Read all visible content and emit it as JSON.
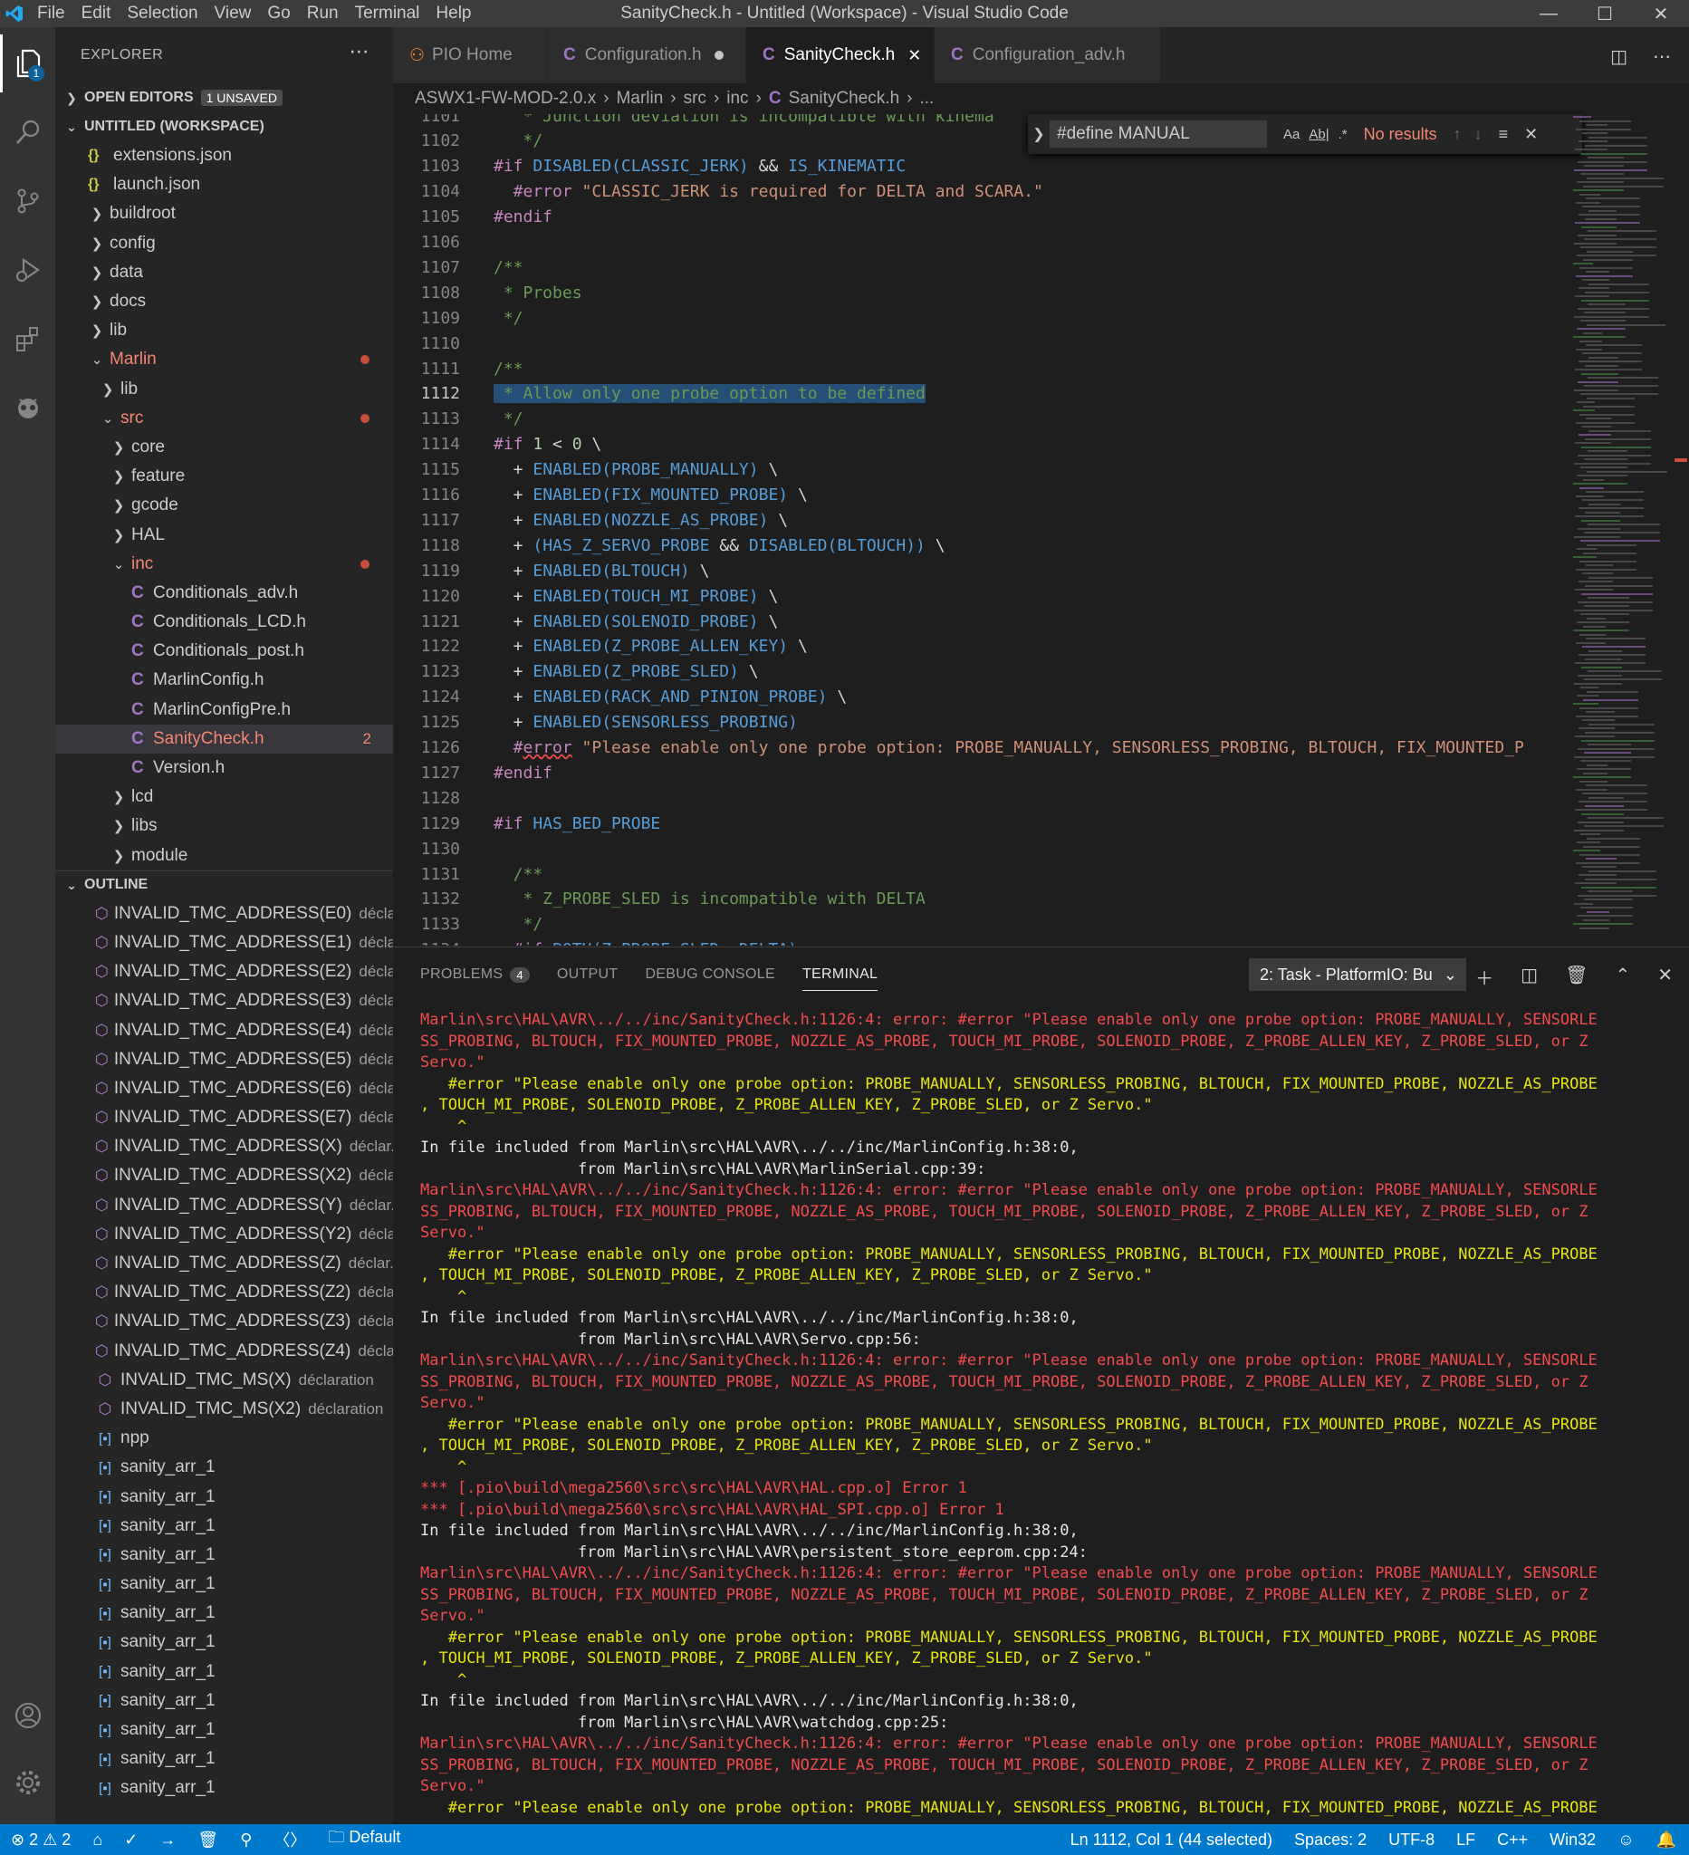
{
  "titlebar": {
    "menu": [
      "File",
      "Edit",
      "Selection",
      "View",
      "Go",
      "Run",
      "Terminal",
      "Help"
    ],
    "title": "SanityCheck.h - Untitled (Workspace) - Visual Studio Code"
  },
  "activity": {
    "explorer_badge": "1"
  },
  "sidebar": {
    "header": "EXPLORER",
    "open_editors": "OPEN EDITORS",
    "unsaved": "1 UNSAVED",
    "workspace": "UNTITLED (WORKSPACE)",
    "tree": [
      {
        "label": "extensions.json",
        "type": "json",
        "indent": 36
      },
      {
        "label": "launch.json",
        "type": "json",
        "indent": 36
      },
      {
        "label": "buildroot",
        "type": "folder",
        "indent": 36
      },
      {
        "label": "config",
        "type": "folder",
        "indent": 36
      },
      {
        "label": "data",
        "type": "folder",
        "indent": 36
      },
      {
        "label": "docs",
        "type": "folder",
        "indent": 36
      },
      {
        "label": "lib",
        "type": "folder",
        "indent": 36
      },
      {
        "label": "Marlin",
        "type": "folder-open",
        "indent": 36,
        "err": true,
        "dot": true
      },
      {
        "label": "lib",
        "type": "folder",
        "indent": 48
      },
      {
        "label": "src",
        "type": "folder-open",
        "indent": 48,
        "err": true,
        "dot": true
      },
      {
        "label": "core",
        "type": "folder",
        "indent": 60
      },
      {
        "label": "feature",
        "type": "folder",
        "indent": 60
      },
      {
        "label": "gcode",
        "type": "folder",
        "indent": 60
      },
      {
        "label": "HAL",
        "type": "folder",
        "indent": 60
      },
      {
        "label": "inc",
        "type": "folder-open",
        "indent": 60,
        "err": true,
        "dot": true
      },
      {
        "label": "Conditionals_adv.h",
        "type": "c",
        "indent": 72
      },
      {
        "label": "Conditionals_LCD.h",
        "type": "c",
        "indent": 72
      },
      {
        "label": "Conditionals_post.h",
        "type": "c",
        "indent": 72
      },
      {
        "label": "MarlinConfig.h",
        "type": "c",
        "indent": 72
      },
      {
        "label": "MarlinConfigPre.h",
        "type": "c",
        "indent": 72
      },
      {
        "label": "SanityCheck.h",
        "type": "c",
        "indent": 72,
        "err": true,
        "selected": true,
        "count": "2"
      },
      {
        "label": "Version.h",
        "type": "c",
        "indent": 72
      },
      {
        "label": "lcd",
        "type": "folder",
        "indent": 60
      },
      {
        "label": "libs",
        "type": "folder",
        "indent": 60
      },
      {
        "label": "module",
        "type": "folder",
        "indent": 60
      }
    ],
    "outline_title": "OUTLINE",
    "outline": [
      {
        "label": "INVALID_TMC_ADDRESS(E0)",
        "detail": "déclа...",
        "kind": "sym"
      },
      {
        "label": "INVALID_TMC_ADDRESS(E1)",
        "detail": "déclа...",
        "kind": "sym"
      },
      {
        "label": "INVALID_TMC_ADDRESS(E2)",
        "detail": "déclа...",
        "kind": "sym"
      },
      {
        "label": "INVALID_TMC_ADDRESS(E3)",
        "detail": "déclа...",
        "kind": "sym"
      },
      {
        "label": "INVALID_TMC_ADDRESS(E4)",
        "detail": "déclа...",
        "kind": "sym"
      },
      {
        "label": "INVALID_TMC_ADDRESS(E5)",
        "detail": "déclа...",
        "kind": "sym"
      },
      {
        "label": "INVALID_TMC_ADDRESS(E6)",
        "detail": "déclа...",
        "kind": "sym"
      },
      {
        "label": "INVALID_TMC_ADDRESS(E7)",
        "detail": "déclа...",
        "kind": "sym"
      },
      {
        "label": "INVALID_TMC_ADDRESS(X)",
        "detail": "déclar...",
        "kind": "sym"
      },
      {
        "label": "INVALID_TMC_ADDRESS(X2)",
        "detail": "déclа...",
        "kind": "sym"
      },
      {
        "label": "INVALID_TMC_ADDRESS(Y)",
        "detail": "déclar...",
        "kind": "sym"
      },
      {
        "label": "INVALID_TMC_ADDRESS(Y2)",
        "detail": "déclа...",
        "kind": "sym"
      },
      {
        "label": "INVALID_TMC_ADDRESS(Z)",
        "detail": "déclar...",
        "kind": "sym"
      },
      {
        "label": "INVALID_TMC_ADDRESS(Z2)",
        "detail": "déclа...",
        "kind": "sym"
      },
      {
        "label": "INVALID_TMC_ADDRESS(Z3)",
        "detail": "déclа...",
        "kind": "sym"
      },
      {
        "label": "INVALID_TMC_ADDRESS(Z4)",
        "detail": "déclа...",
        "kind": "sym"
      },
      {
        "label": "INVALID_TMC_MS(X)",
        "detail": "déclaration",
        "kind": "sym"
      },
      {
        "label": "INVALID_TMC_MS(X2)",
        "detail": "déclaration",
        "kind": "sym"
      },
      {
        "label": "npp",
        "detail": "",
        "kind": "var"
      },
      {
        "label": "sanity_arr_1",
        "detail": "",
        "kind": "var"
      },
      {
        "label": "sanity_arr_1",
        "detail": "",
        "kind": "var"
      },
      {
        "label": "sanity_arr_1",
        "detail": "",
        "kind": "var"
      },
      {
        "label": "sanity_arr_1",
        "detail": "",
        "kind": "var"
      },
      {
        "label": "sanity_arr_1",
        "detail": "",
        "kind": "var"
      },
      {
        "label": "sanity_arr_1",
        "detail": "",
        "kind": "var"
      },
      {
        "label": "sanity_arr_1",
        "detail": "",
        "kind": "var"
      },
      {
        "label": "sanity_arr_1",
        "detail": "",
        "kind": "var"
      },
      {
        "label": "sanity_arr_1",
        "detail": "",
        "kind": "var"
      },
      {
        "label": "sanity_arr_1",
        "detail": "",
        "kind": "var"
      },
      {
        "label": "sanity_arr_1",
        "detail": "",
        "kind": "var"
      },
      {
        "label": "sanity_arr_1",
        "detail": "",
        "kind": "var"
      }
    ]
  },
  "tabs": [
    {
      "label": "PIO Home",
      "icon": "pio",
      "active": false
    },
    {
      "label": "Configuration.h",
      "icon": "c",
      "active": false,
      "modified": true
    },
    {
      "label": "SanityCheck.h",
      "icon": "c",
      "active": true
    },
    {
      "label": "Configuration_adv.h",
      "icon": "c",
      "active": false
    }
  ],
  "breadcrumb": [
    "ASWX1-FW-MOD-2.0.x",
    "Marlin",
    "src",
    "inc",
    "SanityCheck.h",
    "..."
  ],
  "find": {
    "value": "#define MANUAL",
    "opt_case": "Aa",
    "opt_word": "Ab|",
    "opt_regex": ".*",
    "result": "No results"
  },
  "code": [
    {
      "n": "1101",
      "html": "<span class=\"cm\">   * Junction deviation is incompatible with kinema</span>"
    },
    {
      "n": "1102",
      "html": "<span class=\"cm\">   */</span>"
    },
    {
      "n": "1103",
      "html": "<span class=\"kw\">#if</span> <span class=\"mac\">DISABLED(CLASSIC_JERK)</span> <span class=\"tx\">&&</span> <span class=\"mac\">IS_KINEMATIC</span>"
    },
    {
      "n": "1104",
      "html": "<span class=\"kw\">  #error</span> <span class=\"str\">\"CLASSIC_JERK is required for DELTA and SCARA.\"</span>"
    },
    {
      "n": "1105",
      "html": "<span class=\"kw\">#endif</span>"
    },
    {
      "n": "1106",
      "html": ""
    },
    {
      "n": "1107",
      "html": "<span class=\"cm\">/**</span>"
    },
    {
      "n": "1108",
      "html": "<span class=\"cm\"> * Probes</span>"
    },
    {
      "n": "1109",
      "html": "<span class=\"cm\"> */</span>"
    },
    {
      "n": "1110",
      "html": ""
    },
    {
      "n": "1111",
      "html": "<span class=\"cm\">/**</span>"
    },
    {
      "n": "1112",
      "html": "<span class=\"cm sel\"> * Allow only one probe option to be defined</span>",
      "cur": true
    },
    {
      "n": "1113",
      "html": "<span class=\"cm\"> */</span>"
    },
    {
      "n": "1114",
      "html": "<span class=\"kw\">#if</span> <span class=\"num\">1</span> <span class=\"tx\">&lt;</span> <span class=\"num\">0</span> <span class=\"tx\">\\</span>"
    },
    {
      "n": "1115",
      "html": "<span class=\"tx\">  +</span> <span class=\"mac\">ENABLED(PROBE_MANUALLY)</span> <span class=\"tx\">\\</span>"
    },
    {
      "n": "1116",
      "html": "<span class=\"tx\">  +</span> <span class=\"mac\">ENABLED(FIX_MOUNTED_PROBE)</span> <span class=\"tx\">\\</span>"
    },
    {
      "n": "1117",
      "html": "<span class=\"tx\">  +</span> <span class=\"mac\">ENABLED(NOZZLE_AS_PROBE)</span> <span class=\"tx\">\\</span>"
    },
    {
      "n": "1118",
      "html": "<span class=\"tx\">  +</span> <span class=\"mac\">(HAS_Z_SERVO_PROBE</span> <span class=\"tx\">&&</span> <span class=\"mac\">DISABLED(BLTOUCH))</span> <span class=\"tx\">\\</span>"
    },
    {
      "n": "1119",
      "html": "<span class=\"tx\">  +</span> <span class=\"mac\">ENABLED(BLTOUCH)</span> <span class=\"tx\">\\</span>"
    },
    {
      "n": "1120",
      "html": "<span class=\"tx\">  +</span> <span class=\"mac\">ENABLED(TOUCH_MI_PROBE)</span> <span class=\"tx\">\\</span>"
    },
    {
      "n": "1121",
      "html": "<span class=\"tx\">  +</span> <span class=\"mac\">ENABLED(SOLENOID_PROBE)</span> <span class=\"tx\">\\</span>"
    },
    {
      "n": "1122",
      "html": "<span class=\"tx\">  +</span> <span class=\"mac\">ENABLED(Z_PROBE_ALLEN_KEY)</span> <span class=\"tx\">\\</span>"
    },
    {
      "n": "1123",
      "html": "<span class=\"tx\">  +</span> <span class=\"mac\">ENABLED(Z_PROBE_SLED)</span> <span class=\"tx\">\\</span>"
    },
    {
      "n": "1124",
      "html": "<span class=\"tx\">  +</span> <span class=\"mac\">ENABLED(RACK_AND_PINION_PROBE)</span> <span class=\"tx\">\\</span>"
    },
    {
      "n": "1125",
      "html": "<span class=\"tx\">  +</span> <span class=\"mac\">ENABLED(SENSORLESS_PROBING)</span>"
    },
    {
      "n": "1126",
      "html": "<span class=\"kw\">  #</span><span class=\"kw squig\">error</span> <span class=\"str\">\"Please enable only one probe option: PROBE_MANUALLY, SENSORLESS_PROBING, BLTOUCH, FIX_MOUNTED_P</span>"
    },
    {
      "n": "1127",
      "html": "<span class=\"kw\">#endif</span>"
    },
    {
      "n": "1128",
      "html": ""
    },
    {
      "n": "1129",
      "html": "<span class=\"kw\">#if</span> <span class=\"mac\">HAS_BED_PROBE</span>"
    },
    {
      "n": "1130",
      "html": ""
    },
    {
      "n": "1131",
      "html": "<span class=\"cm\">  /**</span>"
    },
    {
      "n": "1132",
      "html": "<span class=\"cm\">   * Z_PROBE_SLED is incompatible with DELTA</span>"
    },
    {
      "n": "1133",
      "html": "<span class=\"cm\">   */</span>"
    },
    {
      "n": "1134",
      "html": "<span class=\"kw\">  #if</span> <span class=\"mac\">BOTH(Z_PROBE_SLED, DELTA)</span>"
    }
  ],
  "panel": {
    "tabs": [
      "PROBLEMS",
      "OUTPUT",
      "DEBUG CONSOLE",
      "TERMINAL"
    ],
    "problems_count": "4",
    "task": "2: Task - PlatformIO: Bu",
    "terminal": [
      {
        "c": "t-red",
        "t": "Marlin\\src\\HAL\\AVR\\../../inc/SanityCheck.h:1126:4: error: #error \"Please enable only one probe option: PROBE_MANUALLY, SENSORLE"
      },
      {
        "c": "t-red",
        "t": "SS_PROBING, BLTOUCH, FIX_MOUNTED_PROBE, NOZZLE_AS_PROBE, TOUCH_MI_PROBE, SOLENOID_PROBE, Z_PROBE_ALLEN_KEY, Z_PROBE_SLED, or Z"
      },
      {
        "c": "t-red",
        "t": "Servo.\""
      },
      {
        "c": "t-yel",
        "t": "   #error \"Please enable only one probe option: PROBE_MANUALLY, SENSORLESS_PROBING, BLTOUCH, FIX_MOUNTED_PROBE, NOZZLE_AS_PROBE"
      },
      {
        "c": "t-yel",
        "t": ", TOUCH_MI_PROBE, SOLENOID_PROBE, Z_PROBE_ALLEN_KEY, Z_PROBE_SLED, or Z Servo.\""
      },
      {
        "c": "t-yel",
        "t": "    ^"
      },
      {
        "c": "t-wht",
        "t": "In file included from Marlin\\src\\HAL\\AVR\\../../inc/MarlinConfig.h:38:0,"
      },
      {
        "c": "t-wht",
        "t": "                 from Marlin\\src\\HAL\\AVR\\MarlinSerial.cpp:39:"
      },
      {
        "c": "t-red",
        "t": "Marlin\\src\\HAL\\AVR\\../../inc/SanityCheck.h:1126:4: error: #error \"Please enable only one probe option: PROBE_MANUALLY, SENSORLE"
      },
      {
        "c": "t-red",
        "t": "SS_PROBING, BLTOUCH, FIX_MOUNTED_PROBE, NOZZLE_AS_PROBE, TOUCH_MI_PROBE, SOLENOID_PROBE, Z_PROBE_ALLEN_KEY, Z_PROBE_SLED, or Z"
      },
      {
        "c": "t-red",
        "t": "Servo.\""
      },
      {
        "c": "t-yel",
        "t": "   #error \"Please enable only one probe option: PROBE_MANUALLY, SENSORLESS_PROBING, BLTOUCH, FIX_MOUNTED_PROBE, NOZZLE_AS_PROBE"
      },
      {
        "c": "t-yel",
        "t": ", TOUCH_MI_PROBE, SOLENOID_PROBE, Z_PROBE_ALLEN_KEY, Z_PROBE_SLED, or Z Servo.\""
      },
      {
        "c": "t-yel",
        "t": "    ^"
      },
      {
        "c": "t-wht",
        "t": "In file included from Marlin\\src\\HAL\\AVR\\../../inc/MarlinConfig.h:38:0,"
      },
      {
        "c": "t-wht",
        "t": "                 from Marlin\\src\\HAL\\AVR\\Servo.cpp:56:"
      },
      {
        "c": "t-red",
        "t": "Marlin\\src\\HAL\\AVR\\../../inc/SanityCheck.h:1126:4: error: #error \"Please enable only one probe option: PROBE_MANUALLY, SENSORLE"
      },
      {
        "c": "t-red",
        "t": "SS_PROBING, BLTOUCH, FIX_MOUNTED_PROBE, NOZZLE_AS_PROBE, TOUCH_MI_PROBE, SOLENOID_PROBE, Z_PROBE_ALLEN_KEY, Z_PROBE_SLED, or Z"
      },
      {
        "c": "t-red",
        "t": "Servo.\""
      },
      {
        "c": "t-yel",
        "t": "   #error \"Please enable only one probe option: PROBE_MANUALLY, SENSORLESS_PROBING, BLTOUCH, FIX_MOUNTED_PROBE, NOZZLE_AS_PROBE"
      },
      {
        "c": "t-yel",
        "t": ", TOUCH_MI_PROBE, SOLENOID_PROBE, Z_PROBE_ALLEN_KEY, Z_PROBE_SLED, or Z Servo.\""
      },
      {
        "c": "t-yel",
        "t": "    ^"
      },
      {
        "c": "t-red",
        "t": "*** [.pio\\build\\mega2560\\src\\src\\HAL\\AVR\\HAL.cpp.o] Error 1"
      },
      {
        "c": "t-red",
        "t": "*** [.pio\\build\\mega2560\\src\\src\\HAL\\AVR\\HAL_SPI.cpp.o] Error 1"
      },
      {
        "c": "t-wht",
        "t": "In file included from Marlin\\src\\HAL\\AVR\\../../inc/MarlinConfig.h:38:0,"
      },
      {
        "c": "t-wht",
        "t": "                 from Marlin\\src\\HAL\\AVR\\persistent_store_eeprom.cpp:24:"
      },
      {
        "c": "t-red",
        "t": "Marlin\\src\\HAL\\AVR\\../../inc/SanityCheck.h:1126:4: error: #error \"Please enable only one probe option: PROBE_MANUALLY, SENSORLE"
      },
      {
        "c": "t-red",
        "t": "SS_PROBING, BLTOUCH, FIX_MOUNTED_PROBE, NOZZLE_AS_PROBE, TOUCH_MI_PROBE, SOLENOID_PROBE, Z_PROBE_ALLEN_KEY, Z_PROBE_SLED, or Z"
      },
      {
        "c": "t-red",
        "t": "Servo.\""
      },
      {
        "c": "t-yel",
        "t": "   #error \"Please enable only one probe option: PROBE_MANUALLY, SENSORLESS_PROBING, BLTOUCH, FIX_MOUNTED_PROBE, NOZZLE_AS_PROBE"
      },
      {
        "c": "t-yel",
        "t": ", TOUCH_MI_PROBE, SOLENOID_PROBE, Z_PROBE_ALLEN_KEY, Z_PROBE_SLED, or Z Servo.\""
      },
      {
        "c": "t-yel",
        "t": "    ^"
      },
      {
        "c": "t-wht",
        "t": "In file included from Marlin\\src\\HAL\\AVR\\../../inc/MarlinConfig.h:38:0,"
      },
      {
        "c": "t-wht",
        "t": "                 from Marlin\\src\\HAL\\AVR\\watchdog.cpp:25:"
      },
      {
        "c": "t-red",
        "t": "Marlin\\src\\HAL\\AVR\\../../inc/SanityCheck.h:1126:4: error: #error \"Please enable only one probe option: PROBE_MANUALLY, SENSORLE"
      },
      {
        "c": "t-red",
        "t": "SS_PROBING, BLTOUCH, FIX_MOUNTED_PROBE, NOZZLE_AS_PROBE, TOUCH_MI_PROBE, SOLENOID_PROBE, Z_PROBE_ALLEN_KEY, Z_PROBE_SLED, or Z"
      },
      {
        "c": "t-red",
        "t": "Servo.\""
      },
      {
        "c": "t-yel",
        "t": "   #error \"Please enable only one probe option: PROBE_MANUALLY, SENSORLESS_PROBING, BLTOUCH, FIX_MOUNTED_PROBE, NOZZLE_AS_PROBE"
      }
    ]
  },
  "status": {
    "errors": "2",
    "warnings": "2",
    "env": "Default",
    "position": "Ln 1112, Col 1 (44 selected)",
    "spaces": "Spaces: 2",
    "encoding": "UTF-8",
    "eol": "LF",
    "language": "C++",
    "platform": "Win32"
  }
}
